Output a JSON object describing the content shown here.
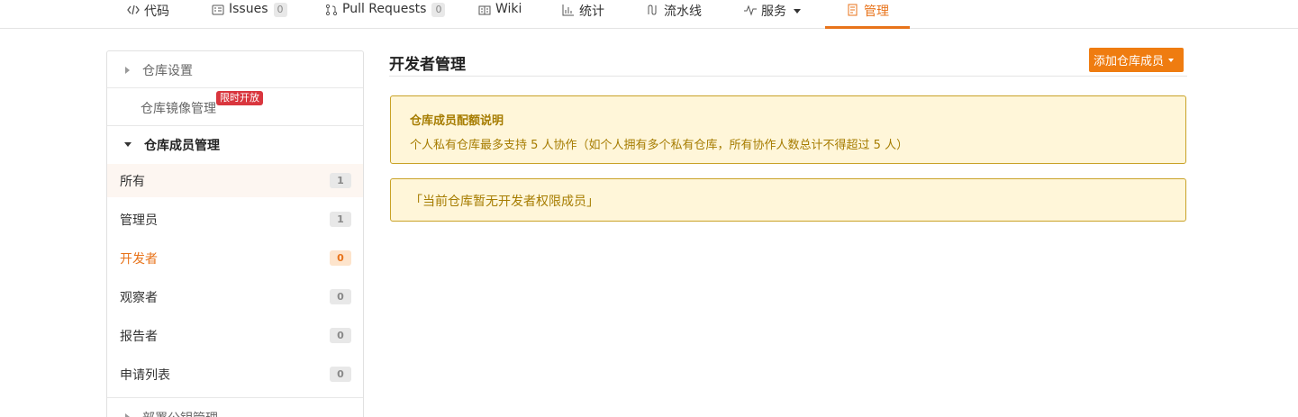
{
  "tabs": [
    {
      "label": "代码",
      "icon": "code-icon"
    },
    {
      "label": "Issues",
      "icon": "issues-icon",
      "count": "0"
    },
    {
      "label": "Pull Requests",
      "icon": "pull-request-icon",
      "count": "0"
    },
    {
      "label": "Wiki",
      "icon": "wiki-icon"
    },
    {
      "label": "统计",
      "icon": "stats-icon"
    },
    {
      "label": "流水线",
      "icon": "pipeline-icon"
    },
    {
      "label": "服务",
      "icon": "service-icon"
    },
    {
      "label": "管理",
      "icon": "manage-icon",
      "active": true
    }
  ],
  "sidebar": {
    "repo_settings": "仓库设置",
    "mirror_management": "仓库镜像管理",
    "limited_badge": "限时开放",
    "member_management": "仓库成员管理",
    "items": [
      {
        "label": "所有",
        "count": "1"
      },
      {
        "label": "管理员",
        "count": "1"
      },
      {
        "label": "开发者",
        "count": "0"
      },
      {
        "label": "观察者",
        "count": "0"
      },
      {
        "label": "报告者",
        "count": "0"
      },
      {
        "label": "申请列表",
        "count": "0"
      }
    ],
    "next_section": "部署公钥管理"
  },
  "main": {
    "title": "开发者管理",
    "add_button": "添加仓库成员",
    "notice_title": "仓库成员配额说明",
    "notice_body": "个人私有仓库最多支持 5 人协作（如个人拥有多个私有仓库，所有协作人数总计不得超过 5 人）",
    "empty_message": "「当前仓库暂无开发者权限成员」"
  },
  "colors": {
    "accent": "#e8731a",
    "notice_bg": "#fff6d9",
    "notice_border": "#c9a227",
    "badge_red": "#d9363e"
  }
}
